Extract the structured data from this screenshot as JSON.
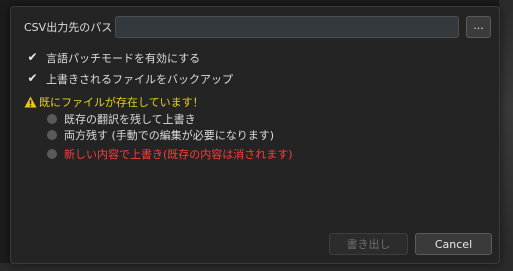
{
  "csv_path": {
    "label": "CSV出力先のパス",
    "value": "",
    "browse_label": "..."
  },
  "options": {
    "language_patch": {
      "label": "言語パッチモードを有効にする",
      "checked": true
    },
    "backup": {
      "label": "上書きされるファイルをバックアップ",
      "checked": true
    }
  },
  "warning": {
    "icon": "warning-icon",
    "text": "既にファイルが存在しています！",
    "color": "#e0d21a"
  },
  "conflict_options": [
    {
      "label": "既存の翻訳を残して上書き"
    },
    {
      "label": "両方残す (手動での編集が必要になります)"
    },
    {
      "label": "新しい内容で上書き(既存の内容は消されます)",
      "color": "#ff3b3b"
    }
  ],
  "buttons": {
    "export_label": "書き出し",
    "cancel_label": "Cancel"
  }
}
